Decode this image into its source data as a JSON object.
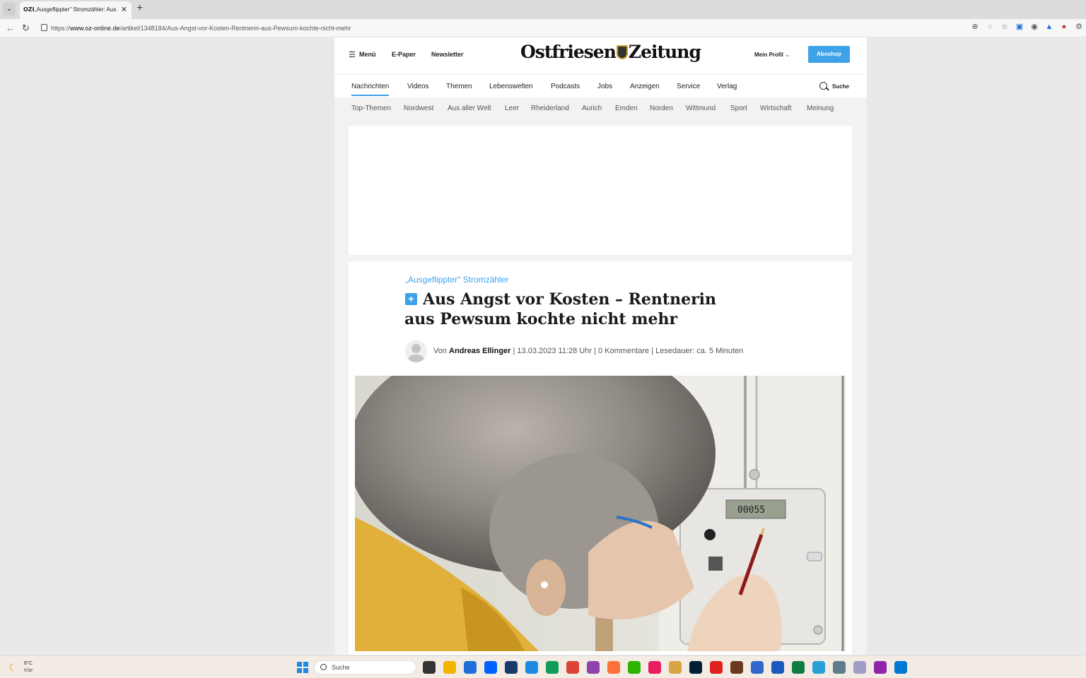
{
  "browser": {
    "tab_list_icon": "chevron-down",
    "tab": {
      "favicon": "OZI",
      "title": "„Ausgeflippter\" Stromzähler: Aus /"
    },
    "new_tab": "+",
    "url_prefix": "https://",
    "url_domain": "www.oz-online.de",
    "url_path": "/artikel/1348184/Aus-Angst-vor-Kosten-Rentnerin-aus-Pewsum-kochte-nicht-mehr"
  },
  "header": {
    "menu_label": "Menü",
    "epaper_label": "E-Paper",
    "newsletter_label": "Newsletter",
    "logo_left": "Ostfriesen",
    "logo_right": "Zeitung",
    "profile_label": "Mein Profil",
    "aboshop_label": "Aboshop"
  },
  "mainnav": {
    "items": [
      "Nachrichten",
      "Videos",
      "Themen",
      "Lebenswelten",
      "Podcasts",
      "Jobs",
      "Anzeigen",
      "Service",
      "Verlag"
    ],
    "active": "Nachrichten",
    "search_label": "Suche"
  },
  "subnav": {
    "items": [
      "Top-Themen",
      "Nordwest",
      "Aus aller Welt",
      "Leer",
      "Rheiderland",
      "Aurich",
      "Emden",
      "Norden",
      "Wittmund",
      "Sport",
      "Wirtschaft",
      "Meinung"
    ]
  },
  "article": {
    "kicker": "„Ausgeflippter\" Stromzähler",
    "plus_badge": "+",
    "headline": "Aus Angst vor Kosten – Rentnerin aus Pewsum kochte nicht mehr",
    "byline_prefix": "Von",
    "author": "Andreas Ellinger",
    "meta": "| 13.03.2023 11:28 Uhr | 0 Kommentare | Lesedauer: ca. 5 Minuten",
    "meter_reading": "00055"
  },
  "taskbar": {
    "weather_temp": "8°C",
    "weather_desc": "Klar",
    "search_label": "Suche",
    "app_colors": [
      "#333333",
      "#f2b400",
      "#1e6fd9",
      "#0061fe",
      "#1a3a6b",
      "#1e88e5",
      "#0f9d58",
      "#db4437",
      "#8e44ad",
      "#ff7139",
      "#2db400",
      "#e91e63",
      "#d9a441",
      "#001e36",
      "#e02020",
      "#6b3a1e",
      "#3366cc",
      "#185abd",
      "#107c41",
      "#2aa0d8",
      "#607d8b",
      "#9e9ec7",
      "#8e24aa",
      "#0078d4"
    ]
  }
}
